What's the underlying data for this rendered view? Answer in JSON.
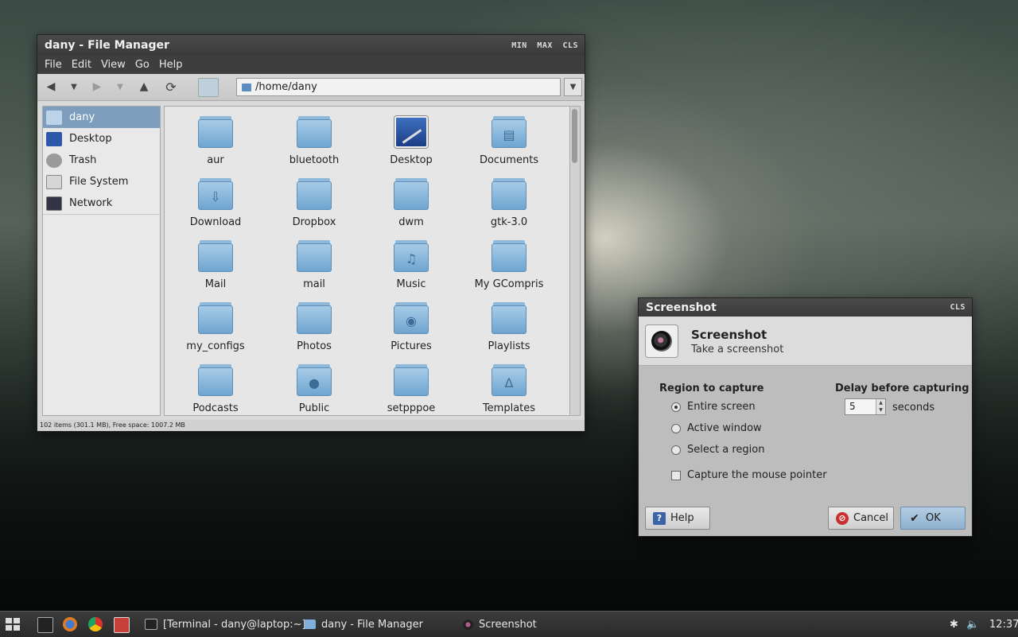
{
  "file_manager": {
    "title": "dany - File Manager",
    "controls": [
      "MIN",
      "MAX",
      "CLS"
    ],
    "menu": [
      "File",
      "Edit",
      "View",
      "Go",
      "Help"
    ],
    "path": "/home/dany",
    "sidebar": [
      {
        "label": "dany",
        "icon": "home-folder-icon"
      },
      {
        "label": "Desktop",
        "icon": "desktop-icon"
      },
      {
        "label": "Trash",
        "icon": "trash-icon"
      },
      {
        "label": "File System",
        "icon": "drive-icon"
      },
      {
        "label": "Network",
        "icon": "network-icon"
      }
    ],
    "files": [
      {
        "name": "aur",
        "icon": "folder-icon"
      },
      {
        "name": "bluetooth",
        "icon": "folder-icon"
      },
      {
        "name": "Desktop",
        "icon": "desktop-icon"
      },
      {
        "name": "Documents",
        "icon": "documents-folder-icon"
      },
      {
        "name": "Download",
        "icon": "download-folder-icon"
      },
      {
        "name": "Dropbox",
        "icon": "folder-icon"
      },
      {
        "name": "dwm",
        "icon": "folder-icon"
      },
      {
        "name": "gtk-3.0",
        "icon": "folder-icon"
      },
      {
        "name": "Mail",
        "icon": "folder-icon"
      },
      {
        "name": "mail",
        "icon": "folder-icon"
      },
      {
        "name": "Music",
        "icon": "music-folder-icon"
      },
      {
        "name": "My GCompris",
        "icon": "folder-icon"
      },
      {
        "name": "my_configs",
        "icon": "folder-icon"
      },
      {
        "name": "Photos",
        "icon": "folder-icon"
      },
      {
        "name": "Pictures",
        "icon": "pictures-folder-icon"
      },
      {
        "name": "Playlists",
        "icon": "folder-icon"
      },
      {
        "name": "Podcasts",
        "icon": "folder-icon"
      },
      {
        "name": "Public",
        "icon": "public-folder-icon"
      },
      {
        "name": "setpppoe",
        "icon": "folder-icon"
      },
      {
        "name": "Templates",
        "icon": "templates-folder-icon"
      }
    ],
    "status": "102 items (301.1 MB), Free space: 1007.2 MB"
  },
  "screenshot_dialog": {
    "title": "Screenshot",
    "close": "CLS",
    "heading": "Screenshot",
    "subheading": "Take a screenshot",
    "region_label": "Region to capture",
    "regions": [
      "Entire screen",
      "Active window",
      "Select a region"
    ],
    "selected_region": "Entire screen",
    "capture_pointer": "Capture the mouse pointer",
    "delay_label": "Delay before capturing",
    "delay_value": "5",
    "delay_unit": "seconds",
    "help_label": "Help",
    "cancel_label": "Cancel",
    "ok_label": "OK"
  },
  "taskbar": {
    "tasks": [
      {
        "label": "[Terminal - dany@laptop:~]",
        "icon": "terminal-icon"
      },
      {
        "label": "dany - File Manager",
        "icon": "folder-icon"
      },
      {
        "label": "Screenshot",
        "icon": "camera-icon"
      }
    ],
    "clock": "12:37"
  }
}
